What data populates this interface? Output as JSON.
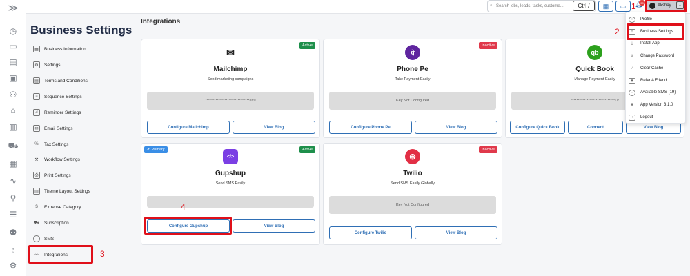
{
  "rail": {
    "icons": [
      "expand-icon",
      "dashboard-icon",
      "inbox-icon",
      "document-icon",
      "wallet-icon",
      "users-icon",
      "store-icon",
      "clipboard-icon",
      "cart-icon",
      "report-icon",
      "chart-icon",
      "network-icon",
      "list-icon",
      "add-user-icon",
      "money-bag-icon",
      "settings-flow-icon"
    ],
    "expand_glyph": "≫"
  },
  "topbar": {
    "search_placeholder": "Search jobs, leads, tasks, custome...",
    "shortcut": "Ctrl /",
    "notification_count": "99",
    "user_name": "Akshay"
  },
  "sidebar": {
    "title": "Business Settings",
    "items": [
      {
        "label": "Business Information",
        "icon": "building-icon"
      },
      {
        "label": "Settings",
        "icon": "gear-icon"
      },
      {
        "label": "Terms and Conditions",
        "icon": "document-icon"
      },
      {
        "label": "Sequence Settings",
        "icon": "sliders-icon"
      },
      {
        "label": "Reminder Settings",
        "icon": "bell-icon"
      },
      {
        "label": "Email Settings",
        "icon": "mail-icon"
      },
      {
        "label": "Tax Settings",
        "icon": "percent-icon"
      },
      {
        "label": "Workflow Settings",
        "icon": "wrench-icon"
      },
      {
        "label": "Print Settings",
        "icon": "printer-icon"
      },
      {
        "label": "Theme Layout Settings",
        "icon": "layout-icon"
      },
      {
        "label": "Expense Category",
        "icon": "dollar-icon"
      },
      {
        "label": "Subscription",
        "icon": "cart-icon"
      },
      {
        "label": "SMS",
        "icon": "sms-icon"
      },
      {
        "label": "Integrations",
        "icon": "link-icon"
      }
    ]
  },
  "main": {
    "title": "Integrations",
    "cards": [
      {
        "name": "Mailchimp",
        "desc": "Send marketing campaigns",
        "status": "Active",
        "key": "******************************es9",
        "btn1": "Configure Mailchimp",
        "btn2": "View Blog",
        "logo_color": "#222222",
        "logo_glyph": "✉"
      },
      {
        "name": "Phone Pe",
        "desc": "Take Payment Easily",
        "status": "Inactive",
        "key": "Key Not Configured",
        "btn1": "Configure Phone Pe",
        "btn2": "View Blog",
        "logo_color": "#5f259f",
        "logo_glyph": "पे"
      },
      {
        "name": "Quick Book",
        "desc": "Manage Payment Easily",
        "status": "",
        "key": "******************************Lk",
        "btn1": "Configure Quick Book",
        "btn2": "Connect",
        "btn3": "View Blog",
        "logo_color": "#2ca01c",
        "logo_glyph": "qb"
      },
      {
        "name": "Gupshup",
        "desc": "Send SMS Easily",
        "status": "Active",
        "primary": "Primary",
        "key": "",
        "btn1": "Configure Gupshup",
        "btn2": "View Blog",
        "logo_color": "#7b3fe4",
        "logo_glyph": "</>"
      },
      {
        "name": "Twilio",
        "desc": "Send SMS Easily Globally",
        "status": "Inactive",
        "key": "Key Not Configured",
        "btn1": "Configure Twilio",
        "btn2": "View Blog",
        "logo_color": "#e22f45",
        "logo_glyph": "⊛"
      }
    ]
  },
  "user_menu": {
    "items": [
      {
        "label": "Profile",
        "icon": "profile-icon"
      },
      {
        "label": "Business Settings",
        "icon": "gear-icon"
      },
      {
        "label": "Install App",
        "icon": "download-icon"
      },
      {
        "label": "Change Password",
        "icon": "key-icon"
      },
      {
        "label": "Clear Cache",
        "icon": "broom-icon"
      },
      {
        "label": "Refer A Friend",
        "icon": "gift-icon"
      },
      {
        "label": "Available SMS (19)",
        "icon": "sms-icon"
      },
      {
        "label": "App Version 3.1.0",
        "icon": "layers-icon"
      },
      {
        "label": "Logout",
        "icon": "logout-icon"
      }
    ]
  },
  "annotations": [
    "1",
    "2",
    "3",
    "4"
  ]
}
